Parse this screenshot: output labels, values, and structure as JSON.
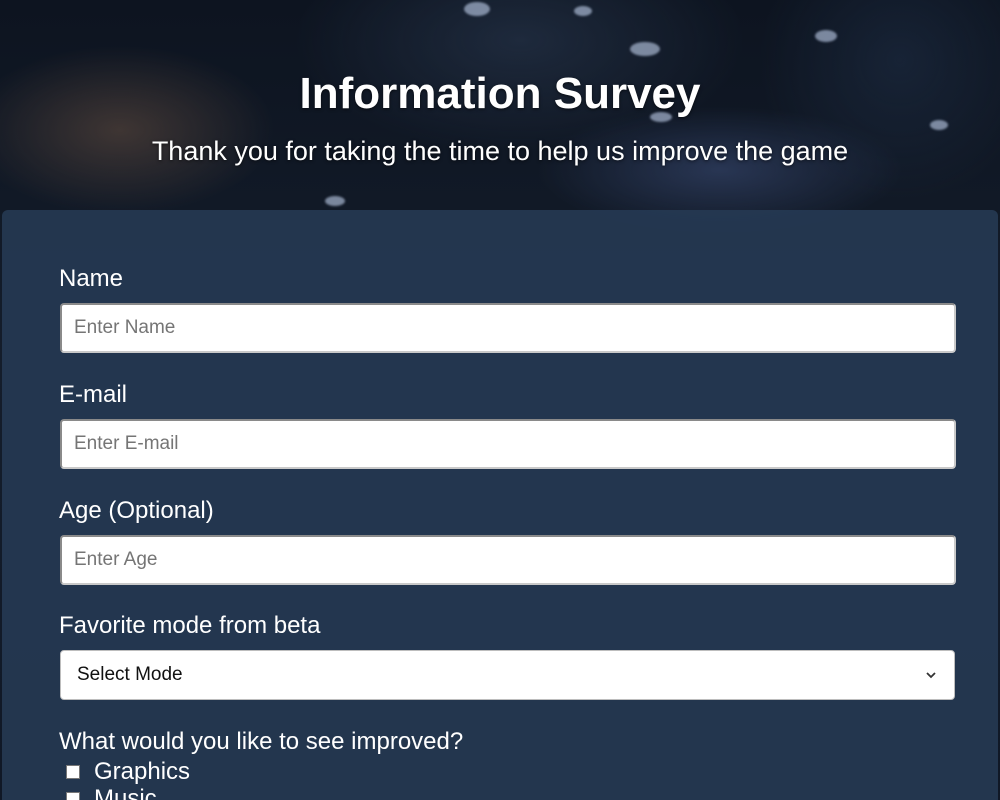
{
  "header": {
    "title": "Information Survey",
    "subtitle": "Thank you for taking the time to help us improve the game"
  },
  "form": {
    "name": {
      "label": "Name",
      "placeholder": "Enter Name",
      "value": ""
    },
    "email": {
      "label": "E-mail",
      "placeholder": "Enter E-mail",
      "value": ""
    },
    "age": {
      "label": "Age (Optional)",
      "placeholder": "Enter Age",
      "value": ""
    },
    "mode": {
      "label": "Favorite mode from beta",
      "selected": "Select Mode"
    },
    "improvements": {
      "label": "What would you like to see improved?",
      "options": [
        {
          "label": "Graphics",
          "checked": false
        },
        {
          "label": "Music",
          "checked": false
        }
      ]
    }
  },
  "colors": {
    "panel": "#263a54",
    "text": "#ffffff",
    "input_bg": "#ffffff",
    "placeholder": "#757575"
  },
  "icons": {
    "select_arrow": "chevron-down-icon"
  }
}
